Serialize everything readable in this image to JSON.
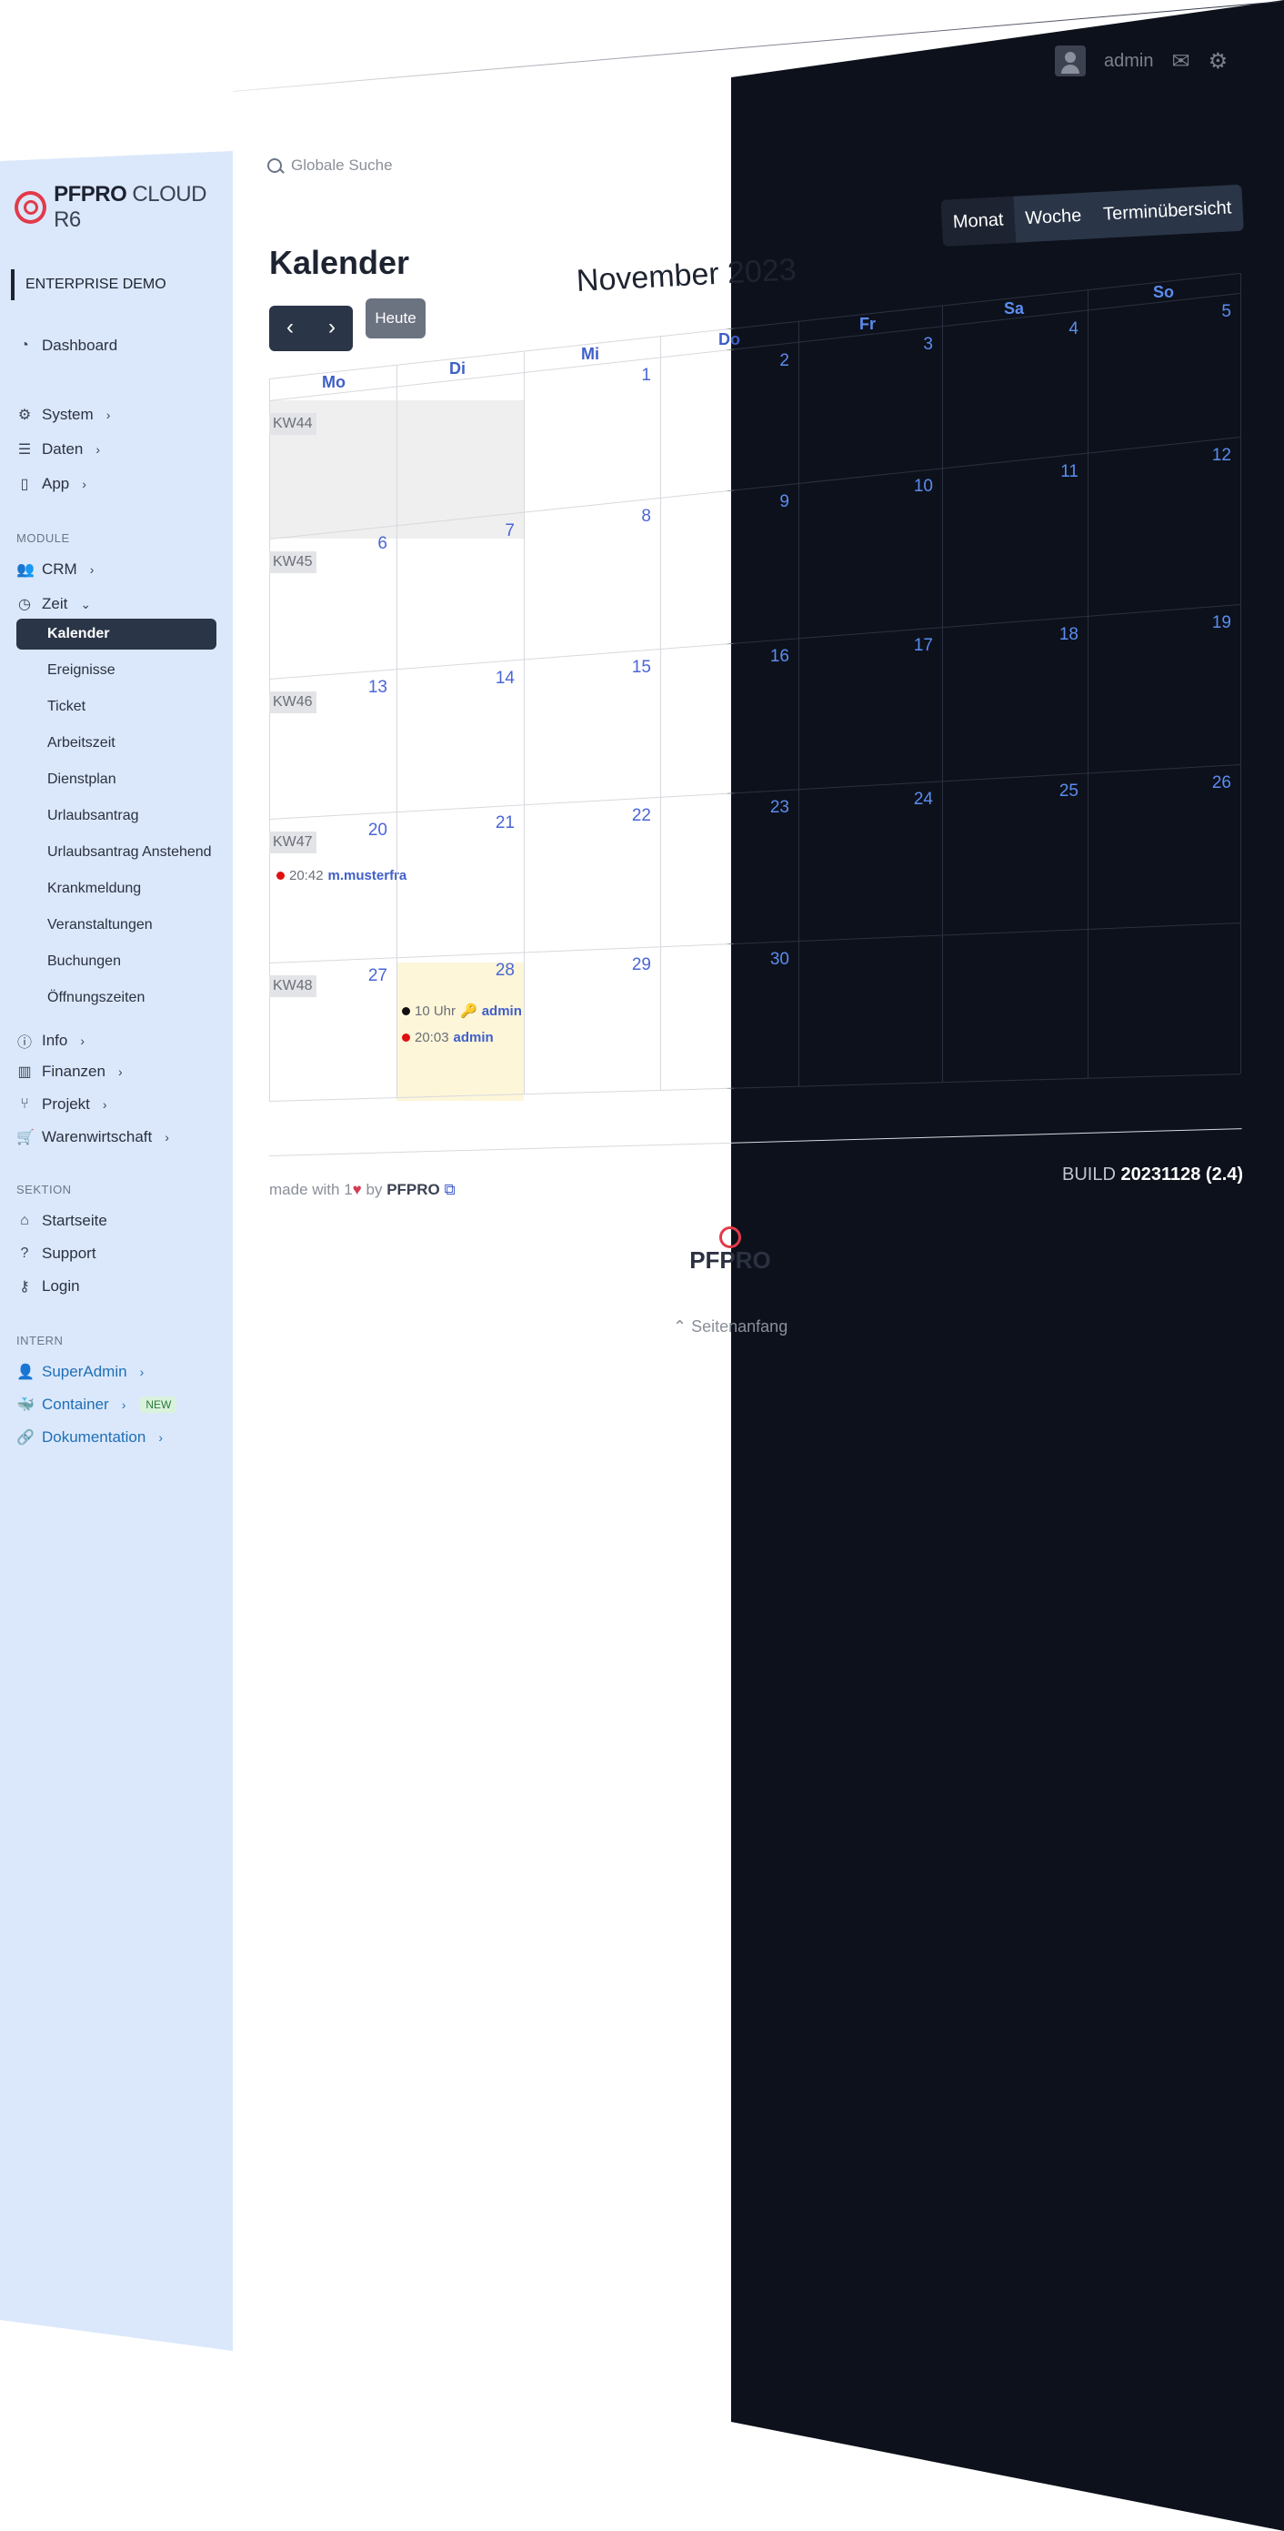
{
  "app": {
    "brand": "PFPRO",
    "brand_suffix": "CLOUD R6",
    "org": "ENTERPRISE DEMO"
  },
  "topbar": {
    "user": "admin"
  },
  "search": {
    "placeholder": "Globale Suche"
  },
  "sidebar": {
    "dashboard": "Dashboard",
    "system": "System",
    "daten": "Daten",
    "app": "App",
    "module_label": "MODULE",
    "crm": "CRM",
    "zeit": "Zeit",
    "zeit_items": [
      "Kalender",
      "Ereignisse",
      "Ticket",
      "Arbeitszeit",
      "Dienstplan",
      "Urlaubsantrag",
      "Urlaubsantrag Anstehend",
      "Krankmeldung",
      "Veranstaltungen",
      "Buchungen",
      "Öffnungszeiten"
    ],
    "info": "Info",
    "finanzen": "Finanzen",
    "projekt": "Projekt",
    "warenwirtschaft": "Warenwirtschaft",
    "sektion_label": "SEKTION",
    "startseite": "Startseite",
    "support": "Support",
    "login": "Login",
    "intern_label": "INTERN",
    "superadmin": "SuperAdmin",
    "container": "Container",
    "new_badge": "NEW",
    "dokumentation": "Dokumentation"
  },
  "calendar": {
    "title": "Kalender",
    "month": "November 2023",
    "today_label": "Heute",
    "views": [
      "Monat",
      "Woche",
      "Terminübersicht"
    ],
    "weekdays": [
      "Mo",
      "Di",
      "Mi",
      "Do",
      "Fr",
      "Sa",
      "So"
    ],
    "weeks": [
      "KW44",
      "KW45",
      "KW46",
      "KW47",
      "KW48"
    ],
    "days": [
      [
        "",
        "",
        "1",
        "2",
        "3",
        "4",
        "5"
      ],
      [
        "6",
        "7",
        "8",
        "9",
        "10",
        "11",
        "12"
      ],
      [
        "13",
        "14",
        "15",
        "16",
        "17",
        "18",
        "19"
      ],
      [
        "20",
        "21",
        "22",
        "23",
        "24",
        "25",
        "26"
      ],
      [
        "27",
        "28",
        "29",
        "30",
        "",
        "",
        ""
      ]
    ],
    "events": [
      {
        "time": "20:42",
        "user": "m.musterfra"
      },
      {
        "time": "10 Uhr",
        "user": "admin"
      },
      {
        "time": "20:03",
        "user": "admin"
      }
    ]
  },
  "footer": {
    "made_with": "made with 1",
    "by": "by",
    "brand": "PFPRO",
    "build_label": "BUILD",
    "build_value": "20231128 (2.4)",
    "center_logo": "PFPRO",
    "back_to_top": "Seitenanfang"
  }
}
